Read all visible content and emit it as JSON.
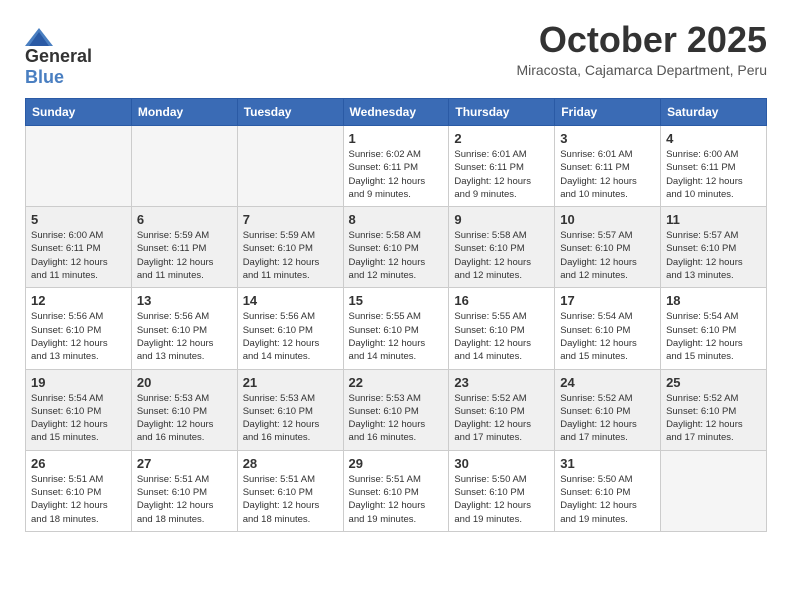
{
  "header": {
    "logo_general": "General",
    "logo_blue": "Blue",
    "month_title": "October 2025",
    "subtitle": "Miracosta, Cajamarca Department, Peru"
  },
  "days_of_week": [
    "Sunday",
    "Monday",
    "Tuesday",
    "Wednesday",
    "Thursday",
    "Friday",
    "Saturday"
  ],
  "weeks": [
    {
      "shaded": false,
      "days": [
        {
          "day": "",
          "empty": true
        },
        {
          "day": "",
          "empty": true
        },
        {
          "day": "",
          "empty": true
        },
        {
          "day": "1",
          "sunrise": "Sunrise: 6:02 AM",
          "sunset": "Sunset: 6:11 PM",
          "daylight": "Daylight: 12 hours and 9 minutes."
        },
        {
          "day": "2",
          "sunrise": "Sunrise: 6:01 AM",
          "sunset": "Sunset: 6:11 PM",
          "daylight": "Daylight: 12 hours and 9 minutes."
        },
        {
          "day": "3",
          "sunrise": "Sunrise: 6:01 AM",
          "sunset": "Sunset: 6:11 PM",
          "daylight": "Daylight: 12 hours and 10 minutes."
        },
        {
          "day": "4",
          "sunrise": "Sunrise: 6:00 AM",
          "sunset": "Sunset: 6:11 PM",
          "daylight": "Daylight: 12 hours and 10 minutes."
        }
      ]
    },
    {
      "shaded": true,
      "days": [
        {
          "day": "5",
          "sunrise": "Sunrise: 6:00 AM",
          "sunset": "Sunset: 6:11 PM",
          "daylight": "Daylight: 12 hours and 11 minutes."
        },
        {
          "day": "6",
          "sunrise": "Sunrise: 5:59 AM",
          "sunset": "Sunset: 6:11 PM",
          "daylight": "Daylight: 12 hours and 11 minutes."
        },
        {
          "day": "7",
          "sunrise": "Sunrise: 5:59 AM",
          "sunset": "Sunset: 6:10 PM",
          "daylight": "Daylight: 12 hours and 11 minutes."
        },
        {
          "day": "8",
          "sunrise": "Sunrise: 5:58 AM",
          "sunset": "Sunset: 6:10 PM",
          "daylight": "Daylight: 12 hours and 12 minutes."
        },
        {
          "day": "9",
          "sunrise": "Sunrise: 5:58 AM",
          "sunset": "Sunset: 6:10 PM",
          "daylight": "Daylight: 12 hours and 12 minutes."
        },
        {
          "day": "10",
          "sunrise": "Sunrise: 5:57 AM",
          "sunset": "Sunset: 6:10 PM",
          "daylight": "Daylight: 12 hours and 12 minutes."
        },
        {
          "day": "11",
          "sunrise": "Sunrise: 5:57 AM",
          "sunset": "Sunset: 6:10 PM",
          "daylight": "Daylight: 12 hours and 13 minutes."
        }
      ]
    },
    {
      "shaded": false,
      "days": [
        {
          "day": "12",
          "sunrise": "Sunrise: 5:56 AM",
          "sunset": "Sunset: 6:10 PM",
          "daylight": "Daylight: 12 hours and 13 minutes."
        },
        {
          "day": "13",
          "sunrise": "Sunrise: 5:56 AM",
          "sunset": "Sunset: 6:10 PM",
          "daylight": "Daylight: 12 hours and 13 minutes."
        },
        {
          "day": "14",
          "sunrise": "Sunrise: 5:56 AM",
          "sunset": "Sunset: 6:10 PM",
          "daylight": "Daylight: 12 hours and 14 minutes."
        },
        {
          "day": "15",
          "sunrise": "Sunrise: 5:55 AM",
          "sunset": "Sunset: 6:10 PM",
          "daylight": "Daylight: 12 hours and 14 minutes."
        },
        {
          "day": "16",
          "sunrise": "Sunrise: 5:55 AM",
          "sunset": "Sunset: 6:10 PM",
          "daylight": "Daylight: 12 hours and 14 minutes."
        },
        {
          "day": "17",
          "sunrise": "Sunrise: 5:54 AM",
          "sunset": "Sunset: 6:10 PM",
          "daylight": "Daylight: 12 hours and 15 minutes."
        },
        {
          "day": "18",
          "sunrise": "Sunrise: 5:54 AM",
          "sunset": "Sunset: 6:10 PM",
          "daylight": "Daylight: 12 hours and 15 minutes."
        }
      ]
    },
    {
      "shaded": true,
      "days": [
        {
          "day": "19",
          "sunrise": "Sunrise: 5:54 AM",
          "sunset": "Sunset: 6:10 PM",
          "daylight": "Daylight: 12 hours and 15 minutes."
        },
        {
          "day": "20",
          "sunrise": "Sunrise: 5:53 AM",
          "sunset": "Sunset: 6:10 PM",
          "daylight": "Daylight: 12 hours and 16 minutes."
        },
        {
          "day": "21",
          "sunrise": "Sunrise: 5:53 AM",
          "sunset": "Sunset: 6:10 PM",
          "daylight": "Daylight: 12 hours and 16 minutes."
        },
        {
          "day": "22",
          "sunrise": "Sunrise: 5:53 AM",
          "sunset": "Sunset: 6:10 PM",
          "daylight": "Daylight: 12 hours and 16 minutes."
        },
        {
          "day": "23",
          "sunrise": "Sunrise: 5:52 AM",
          "sunset": "Sunset: 6:10 PM",
          "daylight": "Daylight: 12 hours and 17 minutes."
        },
        {
          "day": "24",
          "sunrise": "Sunrise: 5:52 AM",
          "sunset": "Sunset: 6:10 PM",
          "daylight": "Daylight: 12 hours and 17 minutes."
        },
        {
          "day": "25",
          "sunrise": "Sunrise: 5:52 AM",
          "sunset": "Sunset: 6:10 PM",
          "daylight": "Daylight: 12 hours and 17 minutes."
        }
      ]
    },
    {
      "shaded": false,
      "days": [
        {
          "day": "26",
          "sunrise": "Sunrise: 5:51 AM",
          "sunset": "Sunset: 6:10 PM",
          "daylight": "Daylight: 12 hours and 18 minutes."
        },
        {
          "day": "27",
          "sunrise": "Sunrise: 5:51 AM",
          "sunset": "Sunset: 6:10 PM",
          "daylight": "Daylight: 12 hours and 18 minutes."
        },
        {
          "day": "28",
          "sunrise": "Sunrise: 5:51 AM",
          "sunset": "Sunset: 6:10 PM",
          "daylight": "Daylight: 12 hours and 18 minutes."
        },
        {
          "day": "29",
          "sunrise": "Sunrise: 5:51 AM",
          "sunset": "Sunset: 6:10 PM",
          "daylight": "Daylight: 12 hours and 19 minutes."
        },
        {
          "day": "30",
          "sunrise": "Sunrise: 5:50 AM",
          "sunset": "Sunset: 6:10 PM",
          "daylight": "Daylight: 12 hours and 19 minutes."
        },
        {
          "day": "31",
          "sunrise": "Sunrise: 5:50 AM",
          "sunset": "Sunset: 6:10 PM",
          "daylight": "Daylight: 12 hours and 19 minutes."
        },
        {
          "day": "",
          "empty": true
        }
      ]
    }
  ]
}
